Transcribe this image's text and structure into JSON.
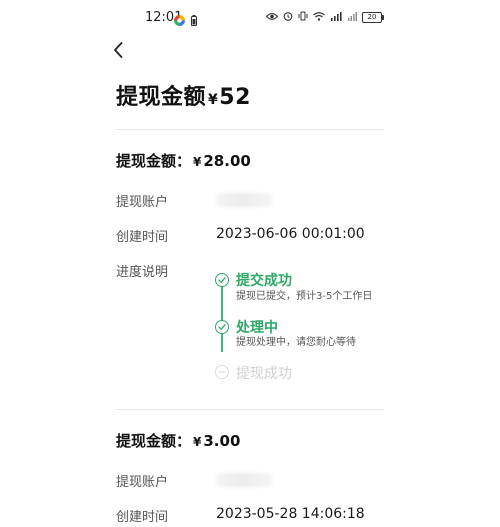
{
  "status_bar": {
    "time": "12:01",
    "battery": "20",
    "icons": [
      "color-wheel-icon",
      "battery-small-icon",
      "eye-icon",
      "alarm-icon",
      "vibrate-icon",
      "wifi-icon",
      "signal-icon",
      "signal-icon-2",
      "battery-icon"
    ]
  },
  "nav": {
    "back_icon": "chevron-left-icon"
  },
  "header": {
    "title_prefix": "提现金额",
    "currency": "¥",
    "amount": "52"
  },
  "records": [
    {
      "amount_label": "提现金额：",
      "currency": "¥",
      "amount": "28.00",
      "account_label": "提现账户",
      "account_value": "",
      "created_label": "创建时间",
      "created_value": "2023-06-06 00:01:00",
      "progress_label": "进度说明",
      "steps": [
        {
          "title": "提交成功",
          "desc": "提现已提交，预计3-5个工作日",
          "status": "done"
        },
        {
          "title": "处理中",
          "desc": "提现处理中，请您耐心等待",
          "status": "done"
        },
        {
          "title": "提现成功",
          "desc": "",
          "status": "pending"
        }
      ]
    },
    {
      "amount_label": "提现金额：",
      "currency": "¥",
      "amount": "3.00",
      "account_label": "提现账户",
      "account_value": "",
      "created_label": "创建时间",
      "created_value": "2023-05-28 14:06:18"
    }
  ],
  "colors": {
    "accent_green": "#2ea867",
    "pending_gray": "#d0d0d0"
  }
}
